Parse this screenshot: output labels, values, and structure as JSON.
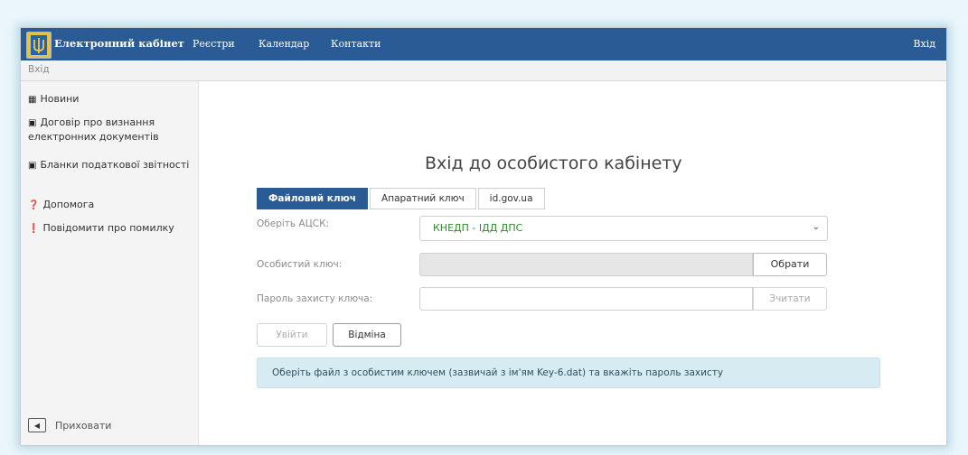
{
  "navbar": {
    "brand": "Електронний кабінет",
    "menu": [
      "Реєстри",
      "Календар",
      "Контакти"
    ],
    "login": "Вхід"
  },
  "breadcrumb": {
    "current": "Вхід"
  },
  "sidebar": {
    "items": [
      {
        "icon": "news-icon",
        "label": "Новини"
      },
      {
        "icon": "document-icon",
        "label": "Договір про визнання електронних документів"
      },
      {
        "icon": "forms-icon",
        "label": "Бланки податкової звітності"
      },
      {
        "icon": "question-icon",
        "label": "Допомога"
      },
      {
        "icon": "exclamation-icon",
        "label": "Повідомити про помилку"
      }
    ],
    "hide_label": "Приховати"
  },
  "main": {
    "title": "Вхід до особистого кабінету",
    "tabs": [
      {
        "label": "Файловий ключ",
        "active": true
      },
      {
        "label": "Апаратний ключ",
        "active": false
      },
      {
        "label": "id.gov.ua",
        "active": false
      }
    ],
    "form": {
      "ca_label": "Оберіть АЦСК:",
      "ca_value": "КНЕДП - ІДД ДПС",
      "key_label": "Особистий ключ:",
      "key_button": "Обрати",
      "password_label": "Пароль захисту ключа:",
      "password_value": "",
      "read_button": "Зчитати",
      "login_button": "Увійти",
      "cancel_button": "Відміна"
    },
    "info": "Оберіть файл з особистим ключем (зазвичай з ім'ям Key-6.dat) та вкажіть пароль захисту"
  },
  "colors": {
    "navbar": "#2a5b95",
    "accent_green": "#2e8b2e",
    "info_bg": "#d6ecf2"
  }
}
